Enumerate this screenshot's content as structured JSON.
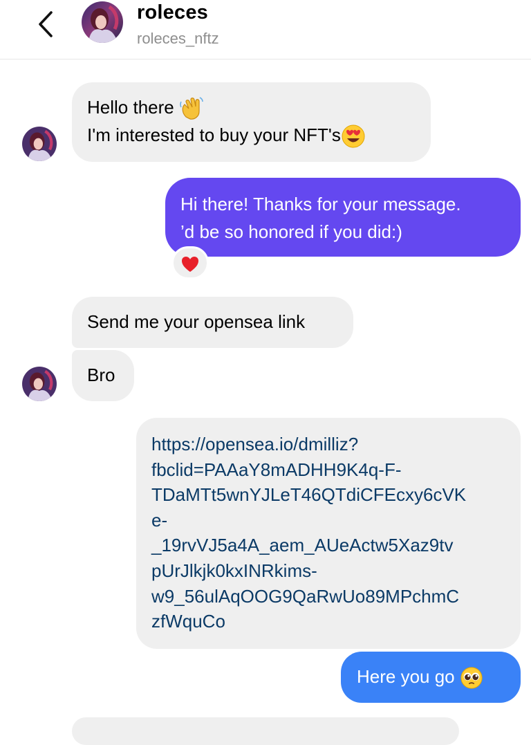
{
  "header": {
    "back_icon": "chevron-left-icon",
    "name": "roleces",
    "username": "roleces_nftz"
  },
  "messages": [
    {
      "id": "m1",
      "from": "them",
      "lines": [
        "Hello there",
        "I'm interested to buy your NFT's"
      ],
      "emojis": [
        "waving-hand-emoji",
        "heart-eyes-emoji"
      ]
    },
    {
      "id": "m2",
      "from": "me",
      "lines": [
        "Hi there! Thanks for your message.",
        "’d be so honored if you did:)"
      ],
      "reaction": "red-heart-emoji"
    },
    {
      "id": "m3",
      "from": "them",
      "lines": [
        "Send me your opensea link"
      ]
    },
    {
      "id": "m4",
      "from": "them",
      "lines": [
        "Bro"
      ]
    },
    {
      "id": "m5",
      "from": "me",
      "type": "link",
      "lines": [
        "https://opensea.io/dmilliz?",
        "fbclid=PAAaY8mADHH9K4q-F-",
        "TDaMTt5wnYJLeT46QTdiCFEcxy6cVK",
        "e-",
        "_19rvVJ5a4A_aem_AUeActw5Xaz9tv",
        "pUrJlkjk0kxINRkims-",
        "w9_56ulAqOOG9QaRwUo89MPchmC",
        "zfWquCo"
      ]
    },
    {
      "id": "m6",
      "from": "me",
      "lines": [
        "Here you go"
      ],
      "emojis": [
        "pleading-face-emoji"
      ]
    }
  ],
  "colors": {
    "incoming_bubble": "#efefef",
    "outgoing_purple": "#6448f0",
    "outgoing_blue": "#3a82f7",
    "link_text": "#0b3a66",
    "secondary_text": "#8e8e8e"
  }
}
